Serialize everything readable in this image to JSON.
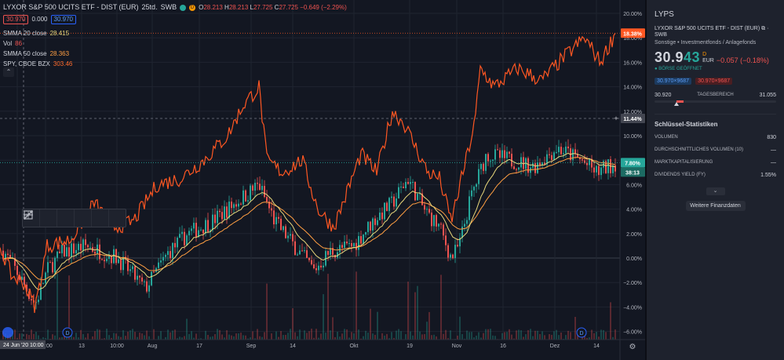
{
  "header": {
    "title": "LYXOR S&P 500 UCITS ETF - DIST (EUR)",
    "interval": "25td.",
    "exchange": "SWB",
    "badge_d": "D",
    "o_label": "O",
    "o_val": "28.213",
    "h_label": "H",
    "h_val": "28.213",
    "l_label": "L",
    "l_val": "27.725",
    "c_label": "C",
    "c_val": "27.725",
    "change": "−0.649 (−2.29%)",
    "box_left": "30.970",
    "mid_val": "0.000",
    "box_right": "30.970"
  },
  "indicators": [
    {
      "label": "SMMA 20 close",
      "value": "28.415",
      "color": "#e8d77b"
    },
    {
      "label": "Vol",
      "value": "86",
      "color": "#ef5350"
    },
    {
      "label": "SMMA 50 close",
      "value": "28.363",
      "color": "#ff9f43"
    },
    {
      "label": "SPY, CBOE BZX",
      "value": "303.46",
      "color": "#ff6a2b"
    }
  ],
  "colors": {
    "background": "#131722",
    "compare": "#ff5722",
    "smma20": "#e8d77b",
    "smma50": "#ff9f43",
    "up": "#26a69a",
    "down": "#ef5350",
    "grid": "#1f2430"
  },
  "axis": {
    "y_ticks": [
      "20.00%",
      "18.00%",
      "16.00%",
      "14.00%",
      "12.00%",
      "10.00%",
      "8.00%",
      "6.00%",
      "4.00%",
      "2.00%",
      "0.00%",
      "−2.00%",
      "−4.00%",
      "−6.00%"
    ],
    "x_ticks": [
      "24 Jun '20",
      "10:00",
      "13",
      "10:00",
      "Aug",
      "17",
      "Sep",
      "14",
      "Okt",
      "19",
      "Nov",
      "16",
      "Dez",
      "14"
    ],
    "cursor_x_label": "24 Jun '20",
    "cursor_x_time": "10:00",
    "cursor_y_label": "11.44%",
    "badge_compare": "18.38%",
    "badge_main": "7.80%",
    "badge_countdown": "38:13",
    "events": [
      "D",
      "D"
    ]
  },
  "sidebar": {
    "symbol": "LYPS",
    "name": "LYXOR S&P 500 UCITS ETF - DIST (EUR)",
    "exchange": "SWB",
    "category": "Sonstige • Investmentfonds / Anlagefonds",
    "price_main": "30.9",
    "price_highlight": "43",
    "price_suffix_top": "D",
    "currency": "EUR",
    "change": "−0.057 (−0.18%)",
    "status": "● BÖRSE GEÖFFNET",
    "bid": "30.970×9687",
    "ask": "30.970×9687",
    "range_low": "30.920",
    "range_label": "TAGESBEREICH",
    "range_high": "31.055",
    "range_fill": 0.2,
    "range_mark": 0.18,
    "stats_title": "Schlüssel-Statistiken",
    "stats": [
      {
        "label": "VOLUMEN",
        "value": "830"
      },
      {
        "label": "DURCHSCHNITTLICHES VOLUMEN (10)",
        "value": "—"
      },
      {
        "label": "MARKTKAPITALISIERUNG",
        "value": "—"
      },
      {
        "label": "DIVIDENDS YIELD (FY)",
        "value": "1.55%"
      }
    ],
    "more_button": "Weitere Finanzdaten"
  }
}
